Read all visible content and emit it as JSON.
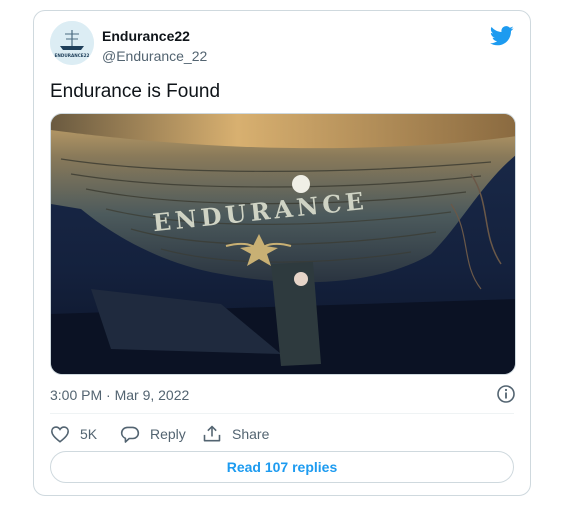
{
  "author": {
    "display_name": "Endurance22",
    "handle": "@Endurance_22",
    "avatar_text": "ENDURANCE22"
  },
  "tweet": {
    "text": "Endurance is Found",
    "timestamp": "3:00 PM · Mar 9, 2022",
    "media_wordmark": "ENDURANCE"
  },
  "actions": {
    "like_count": "5K",
    "reply_label": "Reply",
    "share_label": "Share",
    "read_replies": "Read 107 replies"
  },
  "colors": {
    "accent": "#1d9bf0",
    "muted": "#536471",
    "text": "#0f1419",
    "border": "#cfd9de"
  },
  "icons": [
    "twitter-bird-icon",
    "info-icon",
    "heart-icon",
    "reply-icon",
    "share-icon"
  ]
}
